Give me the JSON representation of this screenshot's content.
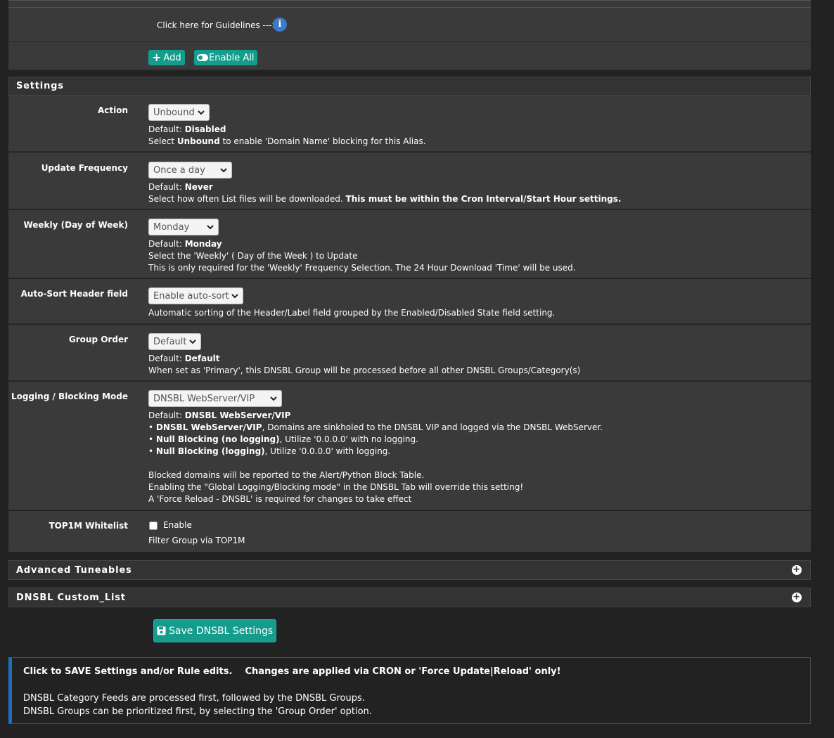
{
  "top": {
    "guidelines_text": "Click here for Guidelines --->",
    "add_label": "Add",
    "enable_all_label": "Enable All"
  },
  "settings": {
    "title": "Settings",
    "action": {
      "label": "Action",
      "value": "Unbound",
      "default_prefix": "Default:",
      "default_value": "Disabled",
      "help_pre": "Select",
      "help_bold": "Unbound",
      "help_post": "to enable 'Domain Name' blocking for this Alias."
    },
    "update_frequency": {
      "label": "Update Frequency",
      "value": "Once a day",
      "default_prefix": "Default:",
      "default_value": "Never",
      "help_pre": "Select how often List files will be downloaded.",
      "help_bold": "This must be within the Cron Interval/Start Hour settings."
    },
    "weekly": {
      "label": "Weekly (Day of Week)",
      "value": "Monday",
      "default_prefix": "Default:",
      "default_value": "Monday",
      "help1": "Select the 'Weekly' ( Day of the Week ) to Update",
      "help2": "This is only required for the 'Weekly' Frequency Selection. The 24 Hour Download 'Time' will be used."
    },
    "autosort": {
      "label": "Auto-Sort Header field",
      "value": "Enable auto-sort",
      "help": "Automatic sorting of the Header/Label field grouped by the Enabled/Disabled State field setting."
    },
    "group_order": {
      "label": "Group Order",
      "value": "Default",
      "default_prefix": "Default:",
      "default_value": "Default",
      "help": "When set as 'Primary', this DNSBL Group will be processed before all other DNSBL Groups/Category(s)"
    },
    "logging": {
      "label": "Logging / Blocking Mode",
      "value": "DNSBL WebServer/VIP",
      "default_prefix": "Default:",
      "default_value": "DNSBL WebServer/VIP",
      "b1_bold": "DNSBL WebServer/VIP",
      "b1_rest": ", Domains are sinkholed to the DNSBL VIP and logged via the DNSBL WebServer.",
      "b2_bold": "Null Blocking (no logging)",
      "b2_rest": ", Utilize '0.0.0.0' with no logging.",
      "b3_bold": "Null Blocking (logging)",
      "b3_rest": ", Utilize '0.0.0.0' with logging.",
      "note1": "Blocked domains will be reported to the Alert/Python Block Table.",
      "note2": "Enabling the \"Global Logging/Blocking mode\" in the DNSBL Tab will override this setting!",
      "note3": "A 'Force Reload - DNSBL' is required for changes to take effect"
    },
    "top1m": {
      "label": "TOP1M Whitelist",
      "checkbox_label": "Enable",
      "checked": false,
      "help": "Filter Group via TOP1M"
    }
  },
  "advanced": {
    "title": "Advanced Tuneables"
  },
  "custom_list": {
    "title": "DNSBL Custom_List"
  },
  "save_label": "Save DNSBL Settings",
  "info": {
    "line1_a": "Click to SAVE Settings and/or Rule edits.",
    "line1_b": "Changes are applied via CRON or 'Force Update|Reload' only!",
    "line2": "DNSBL Category Feeds are processed first, followed by the DNSBL Groups.",
    "line3": "DNSBL Groups can be prioritized first, by selecting the 'Group Order' option."
  },
  "colors": {
    "background": "#222222",
    "panel": "#3a3a3a",
    "accent": "#149c8c",
    "info_border": "#1e6fc0"
  }
}
